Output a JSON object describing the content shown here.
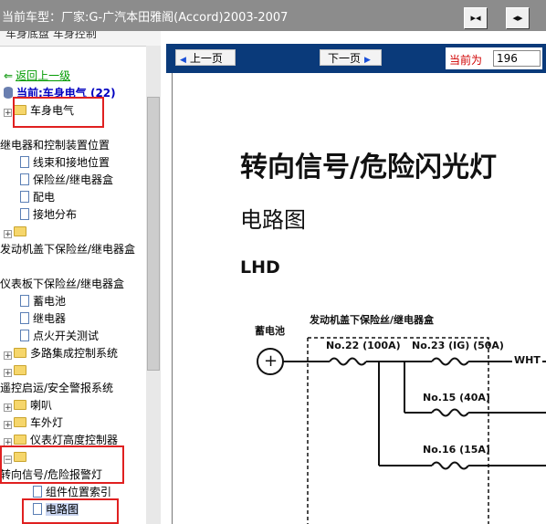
{
  "window": {
    "title": "当前车型：厂家:G-广汽本田雅阁(Accord)2003-2007"
  },
  "left_panel": {
    "tab_strip_text": "车身底盘 车身控制",
    "back_link": "返回上一级",
    "current_label": "当前:车身电气 (22)",
    "tree": [
      {
        "label": "车身电气",
        "type": "folder"
      },
      {
        "label": "继电器和控制装置位置",
        "type": "text"
      },
      {
        "label": "线束和接地位置",
        "type": "doc"
      },
      {
        "label": "保险丝/继电器盒",
        "type": "doc"
      },
      {
        "label": "配电",
        "type": "doc"
      },
      {
        "label": "接地分布",
        "type": "doc"
      },
      {
        "label": "",
        "type": "folder"
      },
      {
        "label": "发动机盖下保险丝/继电器盒",
        "type": "text"
      },
      {
        "label": "仪表板下保险丝/继电器盒",
        "type": "text"
      },
      {
        "label": "蓄电池",
        "type": "doc"
      },
      {
        "label": "继电器",
        "type": "doc"
      },
      {
        "label": "点火开关测试",
        "type": "doc"
      },
      {
        "label": "多路集成控制系统",
        "type": "folder"
      },
      {
        "label": "",
        "type": "folder"
      },
      {
        "label": "遥控启运/安全警报系统",
        "type": "text"
      },
      {
        "label": "喇叭",
        "type": "folder"
      },
      {
        "label": "车外灯",
        "type": "folder"
      },
      {
        "label": "仪表灯高度控制器",
        "type": "folder"
      },
      {
        "label": "",
        "type": "folder"
      },
      {
        "label": "转向信号/危险报警灯",
        "type": "text"
      },
      {
        "label": "组件位置索引",
        "type": "doc"
      },
      {
        "label": "电路图",
        "type": "doc"
      }
    ]
  },
  "nav": {
    "prev_label": "上一页",
    "next_label": "下一页",
    "page_label": "当前为",
    "page_value": "196"
  },
  "document": {
    "heading": "转向信号/危险闪光灯",
    "subheading": "电路图",
    "variant": "LHD",
    "circuit": {
      "battery_label": "蓄电池",
      "box_label": "发动机盖下保险丝/继电器盒",
      "fuse_1": "No.22 (100A)",
      "fuse_2": "No.23 (IG) (50A)",
      "fuse_3": "No.15 (40A)",
      "fuse_4": "No.16 (15A)",
      "wire_label": "WHT",
      "plus_sign": "+"
    }
  },
  "colors": {
    "title_bar": "#8c8c8c",
    "nav_bar": "#0a3a7a",
    "highlight": "#e02020",
    "link_green": "#009a00",
    "current_blue": "#0000c0"
  }
}
